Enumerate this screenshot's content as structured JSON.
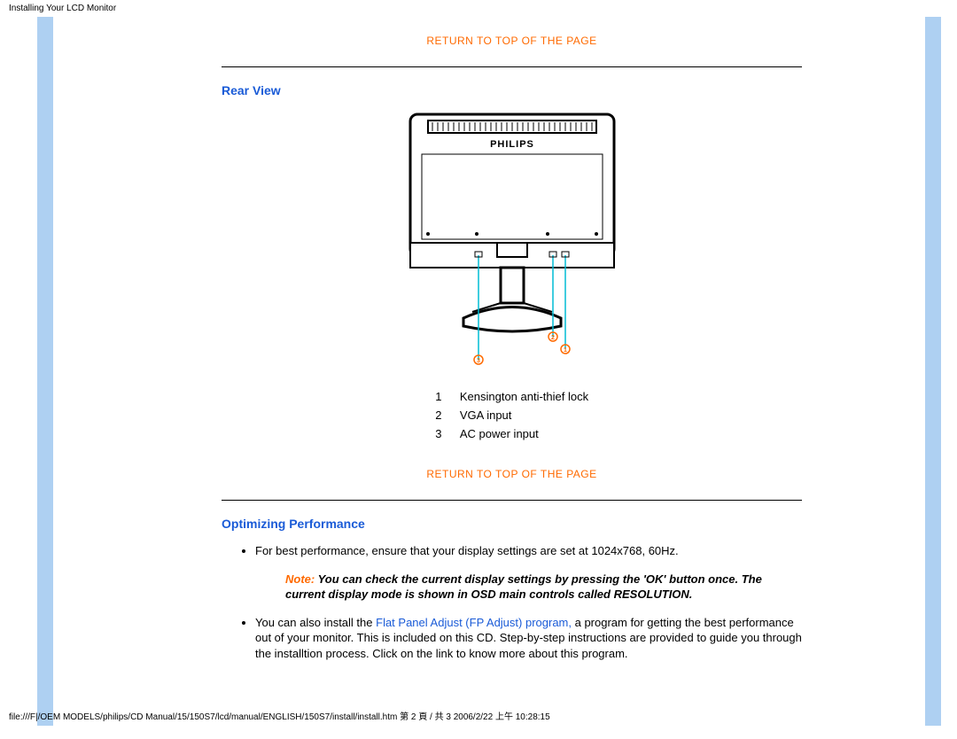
{
  "header": {
    "title": "Installing Your LCD Monitor"
  },
  "links": {
    "return_top": "RETURN TO TOP OF THE PAGE",
    "fp_adjust": "Flat Panel Adjust (FP Adjust) program,"
  },
  "rear": {
    "heading": "Rear View",
    "brand": "PHILIPS",
    "callouts": [
      {
        "n": "1",
        "label": "Kensington anti-thief lock"
      },
      {
        "n": "2",
        "label": "VGA input"
      },
      {
        "n": "3",
        "label": "AC power input"
      }
    ]
  },
  "perf": {
    "heading": "Optimizing Performance",
    "bullet1": "For best performance, ensure that your display settings are set at 1024x768, 60Hz.",
    "note_label": "Note: ",
    "note_body": "You can check the current display settings by pressing the 'OK' button once. The current display mode is shown in OSD main controls called RESOLUTION.",
    "bullet2_pre": "You can also install the ",
    "bullet2_post": " a program for getting the best performance out of your monitor. This is included on this CD. Step-by-step instructions are provided to guide you through the installtion process. Click on the link to know more about this program."
  },
  "footer": {
    "path": "file:///F|/OEM MODELS/philips/CD Manual/15/150S7/lcd/manual/ENGLISH/150S7/install/install.htm 第 2 頁 / 共 3 2006/2/22 上午 10:28:15"
  }
}
